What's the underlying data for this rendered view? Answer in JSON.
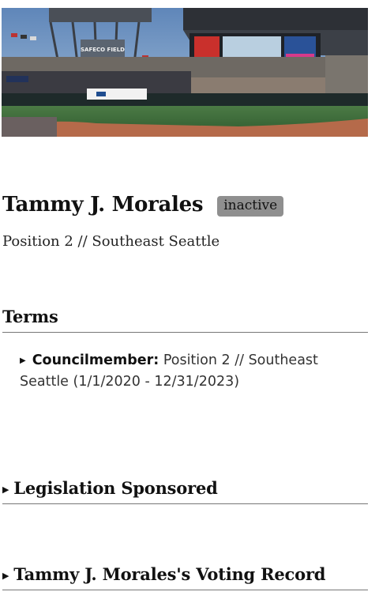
{
  "hero": {
    "image_description": "photo-stadium",
    "sign_text": "SAFECO FIELD"
  },
  "profile": {
    "name": "Tammy J. Morales",
    "status": "inactive",
    "position": "Position 2 // Southeast Seattle"
  },
  "terms": {
    "title": "Terms",
    "entries": [
      {
        "role": "Councilmember:",
        "detail": "Position 2 // Southeast Seattle (1/1/2020 - 12/31/2023)"
      }
    ]
  },
  "legislation": {
    "title": "Legislation Sponsored"
  },
  "voting": {
    "title": "Tammy J. Morales's Voting Record"
  },
  "colors": {
    "badge_bg": "#8f8f8f",
    "rule": "#777777",
    "sky": "#6d8fb8",
    "field": "#3f6a3c"
  }
}
